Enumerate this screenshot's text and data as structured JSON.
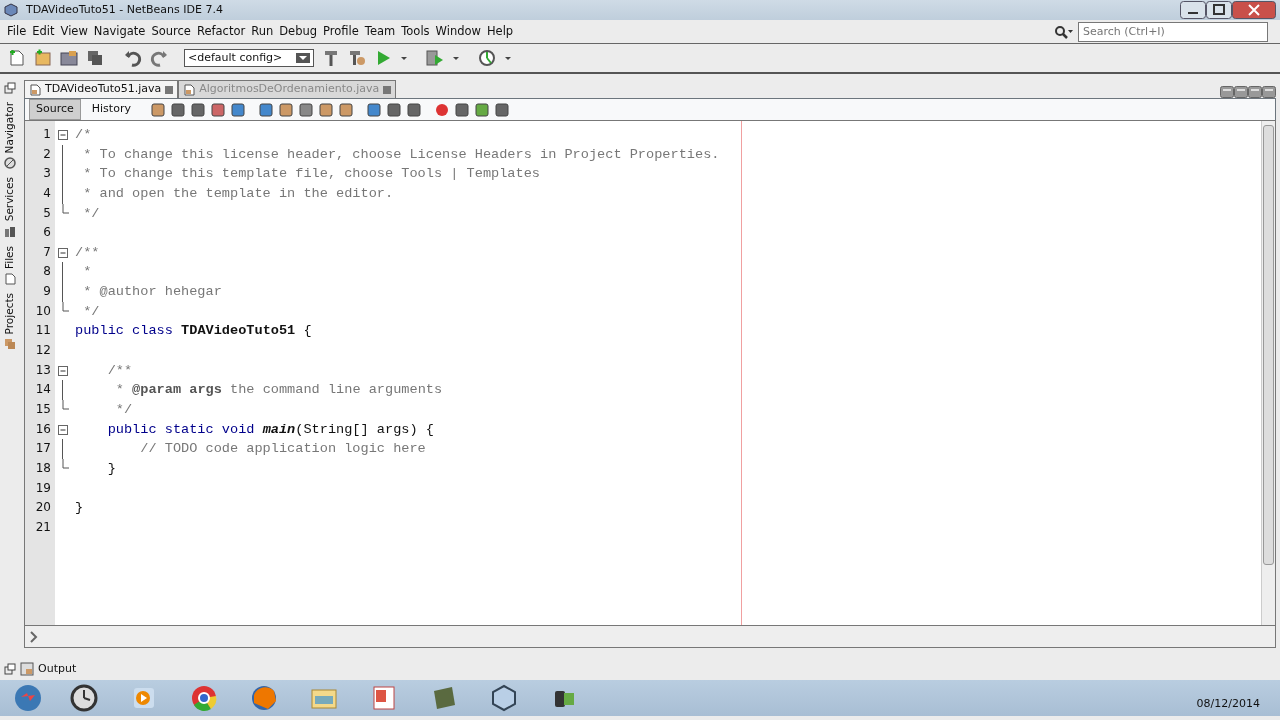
{
  "window": {
    "title": "TDAVideoTuto51 - NetBeans IDE 7.4"
  },
  "menu": [
    {
      "label": "File"
    },
    {
      "label": "Edit"
    },
    {
      "label": "View"
    },
    {
      "label": "Navigate"
    },
    {
      "label": "Source"
    },
    {
      "label": "Refactor"
    },
    {
      "label": "Run"
    },
    {
      "label": "Debug"
    },
    {
      "label": "Profile"
    },
    {
      "label": "Team"
    },
    {
      "label": "Tools"
    },
    {
      "label": "Window"
    },
    {
      "label": "Help"
    }
  ],
  "toolbar": {
    "config": "<default config>"
  },
  "search": {
    "placeholder": "Search (Ctrl+I)"
  },
  "side_tabs": [
    {
      "label": "Navigator"
    },
    {
      "label": "Services"
    },
    {
      "label": "Files"
    },
    {
      "label": "Projects"
    }
  ],
  "editor_tabs": [
    {
      "label": "TDAVideoTuto51.java",
      "selected": true
    },
    {
      "label": "AlgoritmosDeOrdenamiento.java",
      "selected": false
    }
  ],
  "view_tabs": [
    {
      "label": "Source",
      "selected": true
    },
    {
      "label": "History",
      "selected": false
    }
  ],
  "code_lines": [
    {
      "number": "1",
      "fold_start": true,
      "tokens": [
        {
          "kind": "comment",
          "text": "/*"
        }
      ]
    },
    {
      "number": "2",
      "tokens": [
        {
          "kind": "comment",
          "text": " * To change this license header, choose License Headers in Project Properties."
        }
      ]
    },
    {
      "number": "3",
      "tokens": [
        {
          "kind": "comment",
          "text": " * To change this template file, choose Tools | Templates"
        }
      ]
    },
    {
      "number": "4",
      "tokens": [
        {
          "kind": "comment",
          "text": " * and open the template in the editor."
        }
      ]
    },
    {
      "number": "5",
      "fold_end": true,
      "tokens": [
        {
          "kind": "comment",
          "text": " */"
        }
      ]
    },
    {
      "number": "6"
    },
    {
      "number": "7",
      "fold_start": true,
      "tokens": [
        {
          "kind": "comment",
          "text": "/**"
        }
      ]
    },
    {
      "number": "8",
      "tokens": [
        {
          "kind": "comment",
          "text": " *"
        }
      ]
    },
    {
      "number": "9",
      "tokens": [
        {
          "kind": "comment",
          "text": " * @author hehegar"
        }
      ]
    },
    {
      "number": "10",
      "fold_end": true,
      "tokens": [
        {
          "kind": "comment",
          "text": " */"
        }
      ]
    },
    {
      "number": "11",
      "tokens": [
        {
          "kind": "keyword",
          "text": "public class "
        },
        {
          "kind": "classname",
          "text": "TDAVideoTuto51"
        },
        {
          "kind": "plain",
          "text": " {"
        }
      ]
    },
    {
      "number": "12"
    },
    {
      "number": "13",
      "fold_start": true,
      "tokens": [
        {
          "kind": "comment",
          "text": "    /**"
        }
      ]
    },
    {
      "number": "14",
      "tokens": [
        {
          "kind": "comment",
          "text": "     * "
        },
        {
          "kind": "doctag",
          "text": "@param"
        },
        {
          "kind": "doctag",
          "text": " args"
        },
        {
          "kind": "comment",
          "text": " the command line arguments"
        }
      ]
    },
    {
      "number": "15",
      "fold_end": true,
      "tokens": [
        {
          "kind": "comment",
          "text": "     */"
        }
      ]
    },
    {
      "number": "16",
      "fold_start": true,
      "tokens": [
        {
          "kind": "keyword",
          "text": "    public static void "
        },
        {
          "kind": "method",
          "text": "main"
        },
        {
          "kind": "plain",
          "text": "(String[] args) {"
        }
      ]
    },
    {
      "number": "17",
      "tokens": [
        {
          "kind": "comment",
          "text": "        // TODO code application logic here"
        }
      ]
    },
    {
      "number": "18",
      "fold_end": true,
      "tokens": [
        {
          "kind": "plain",
          "text": "    }"
        }
      ]
    },
    {
      "number": "19"
    },
    {
      "number": "20",
      "tokens": [
        {
          "kind": "plain",
          "text": "}"
        }
      ]
    },
    {
      "number": "21"
    }
  ],
  "bottom_panel": {
    "label": "Output"
  },
  "taskbar": {
    "date": "08/12/2014"
  }
}
